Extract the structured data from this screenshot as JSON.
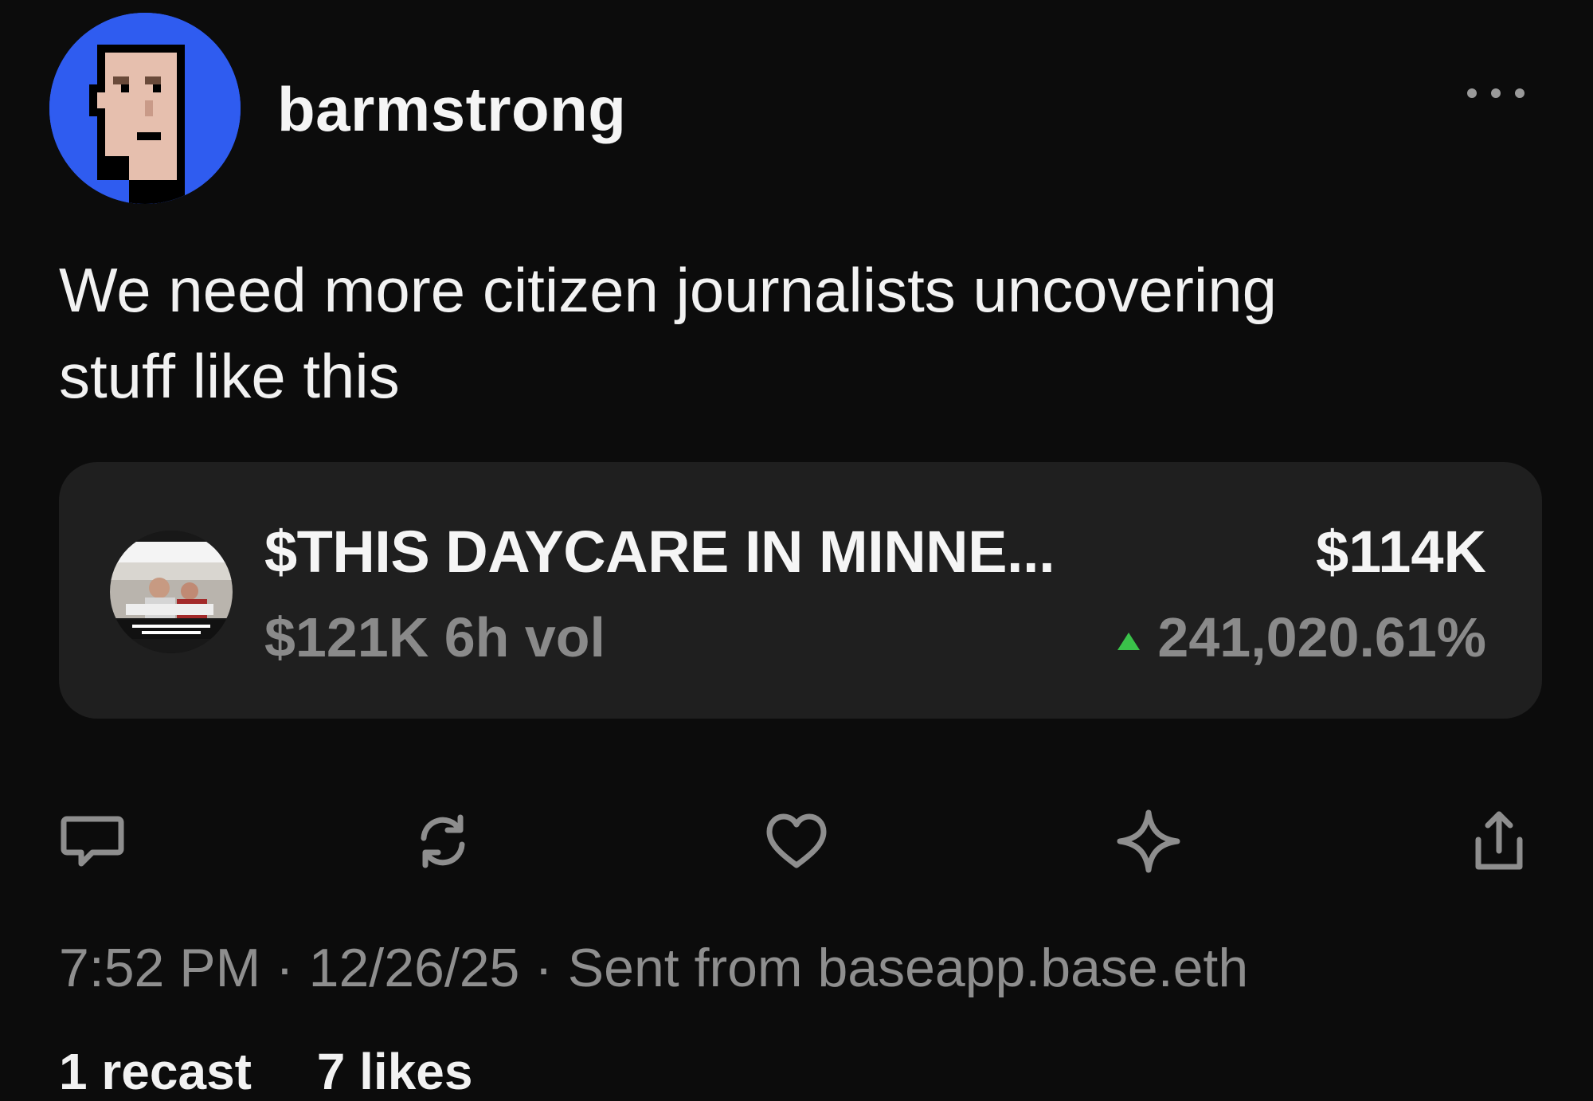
{
  "author": {
    "username": "barmstrong",
    "avatar": "pixel-punk-avatar"
  },
  "post": {
    "text": "We need more citizen journalists uncovering\nstuff like this"
  },
  "token": {
    "name": "$THIS DAYCARE IN MINNE...",
    "price": "$114K",
    "volume": "$121K 6h vol",
    "change": "241,020.61%",
    "change_direction": "up",
    "change_color": "#3ac24a"
  },
  "actions": [
    {
      "icon": "comment-icon"
    },
    {
      "icon": "recast-icon"
    },
    {
      "icon": "heart-icon"
    },
    {
      "icon": "sparkle-icon"
    },
    {
      "icon": "share-icon"
    }
  ],
  "meta": {
    "line": "7:52 PM · 12/26/25 · Sent from baseapp.base.eth"
  },
  "stats": {
    "recasts": "1 recast",
    "likes": "7 likes"
  },
  "colors": {
    "background": "#0c0c0c",
    "card": "#1f1f1f",
    "avatar_bg": "#2f5cf0"
  }
}
